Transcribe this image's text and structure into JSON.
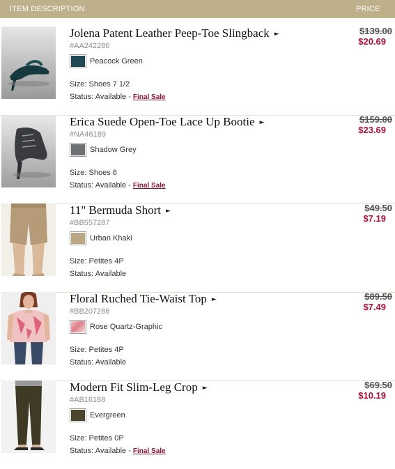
{
  "header": {
    "item_description": "ITEM DESCRIPTION",
    "price": "PRICE"
  },
  "items": [
    {
      "name": "Jolena Patent Leather Peep-Toe Slingback",
      "arrow": "►",
      "sku": "#AA242286",
      "color_name": "Peacock Green",
      "swatch_color": "#1f4a55",
      "size": "Size: Shoes 7 1/2",
      "status_prefix": "Status: Available - ",
      "final_sale": "Final Sale",
      "original_price": "$139.00",
      "sale_price": "$20.69",
      "image": "peep-toe-slingback-shoe"
    },
    {
      "name": "Erica Suede Open-Toe Lace Up Bootie",
      "arrow": "►",
      "sku": "#NA46189",
      "color_name": "Shadow Grey",
      "swatch_color": "#6f7074",
      "size": "Size: Shoes 6",
      "status_prefix": "Status: Available - ",
      "final_sale": "Final Sale",
      "original_price": "$159.00",
      "sale_price": "$23.69",
      "image": "lace-up-bootie"
    },
    {
      "name": "11\" Bermuda Short",
      "arrow": "►",
      "sku": "#BB557287",
      "color_name": "Urban Khaki",
      "swatch_color": "#bba686",
      "size": "Size: Petites 4P",
      "status_prefix": "Status: Available",
      "final_sale": "",
      "original_price": "$49.50",
      "sale_price": "$7.19",
      "image": "bermuda-short"
    },
    {
      "name": "Floral Ruched Tie-Waist Top",
      "arrow": "►",
      "sku": "#BB207286",
      "color_name": "Rose Quartz-Graphic",
      "swatch_color": "#e8a5a8",
      "size": "Size: Petites 4P",
      "status_prefix": "Status: Available",
      "final_sale": "",
      "original_price": "$89.50",
      "sale_price": "$7.49",
      "image": "floral-top-model"
    },
    {
      "name": "Modern Fit Slim-Leg Crop",
      "arrow": "►",
      "sku": "#AB16188",
      "color_name": "Evergreen",
      "swatch_color": "#4a4630",
      "size": "Size: Petites 0P",
      "status_prefix": "Status: Available - ",
      "final_sale": "Final Sale",
      "original_price": "$69.50",
      "sale_price": "$10.19",
      "image": "slim-leg-crop-pants"
    }
  ]
}
